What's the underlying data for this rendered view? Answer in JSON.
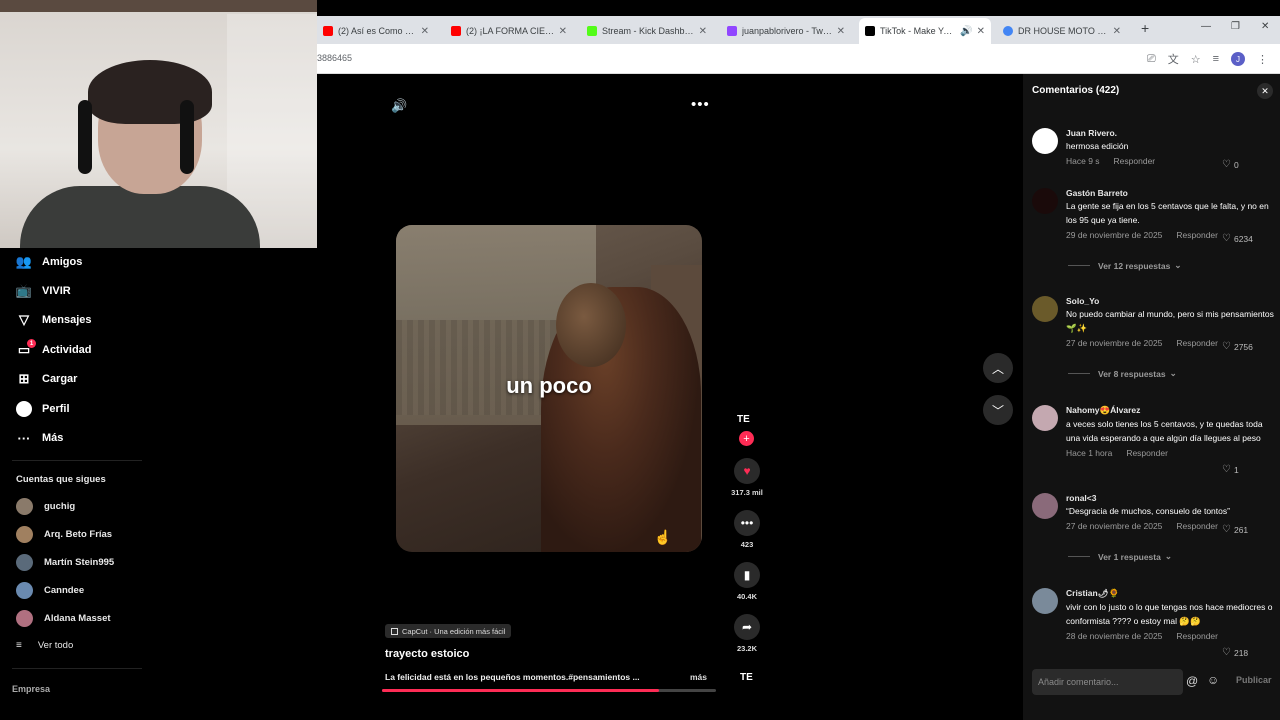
{
  "browser": {
    "tabs": [
      {
        "label": "(2) Así es Como Debes Ent",
        "color": "#ff0000"
      },
      {
        "label": "(2) ¡LA FORMA CIENTÍFICA",
        "color": "#ff0000"
      },
      {
        "label": "Stream - Kick Dashboard",
        "color": "#53fc18"
      },
      {
        "label": "juanpablorivero - Twitch",
        "color": "#9146ff"
      },
      {
        "label": "TikTok - Make Your D",
        "color": "#000000"
      },
      {
        "label": "DR HOUSE MOTO - Busc",
        "color": "#4285f4"
      }
    ],
    "address": "3886465",
    "profile_initial": "J"
  },
  "sidebar": {
    "nav": [
      {
        "label": "Amigos",
        "icon": "friends-icon"
      },
      {
        "label": "VIVIR",
        "icon": "live-icon"
      },
      {
        "label": "Mensajes",
        "icon": "messages-icon"
      },
      {
        "label": "Actividad",
        "icon": "activity-icon",
        "badge": "1"
      },
      {
        "label": "Cargar",
        "icon": "upload-icon"
      },
      {
        "label": "Perfil",
        "icon": "profile-icon"
      },
      {
        "label": "Más",
        "icon": "more-icon"
      }
    ],
    "following_title": "Cuentas que sigues",
    "following": [
      {
        "name": "guchig",
        "color": "#8a7a6a"
      },
      {
        "name": "Arq. Beto Frías",
        "color": "#a08060"
      },
      {
        "name": "Martín Stein995",
        "color": "#5a6a7a"
      },
      {
        "name": "Canndee",
        "color": "#6a8ab0"
      },
      {
        "name": "Aldana Masset",
        "color": "#b07080"
      }
    ],
    "see_all": "Ver todo",
    "footer": "Empresa"
  },
  "video": {
    "caption_overlay": "un poco",
    "likes": "317.3 mil",
    "comments_count": "423",
    "saves": "40.4K",
    "shares": "23.2K",
    "creator_mark": "TE",
    "capcut_tag": "CapCut · Una edición más fácil",
    "author": "trayecto estoico",
    "description": "La felicidad está en los pequeños momentos.#pensamientos ...",
    "more_label": "más",
    "progress": 0.83,
    "accent": "#fe2c55"
  },
  "comments_panel": {
    "title": "Comentarios (422)",
    "items": [
      {
        "user": "Juan Rivero.",
        "text": "hermosa edición",
        "date": "Hace 9 s",
        "reply": "Responder",
        "likes": "0",
        "avatar": "#ffffff"
      },
      {
        "user": "Gastón Barreto",
        "text": "La gente se fija en los 5 centavos que le falta, y no en los 95 que ya tiene.",
        "date": "29 de noviembre de 2025",
        "reply": "Responder",
        "likes": "6234",
        "avatar": "#1a0a0a",
        "replies": "Ver 12 respuestas"
      },
      {
        "user": "Solo_Yo",
        "text": "No puedo cambiar al mundo, pero si mis pensamientos 🌱✨",
        "date": "27 de noviembre de 2025",
        "reply": "Responder",
        "likes": "2756",
        "avatar": "#6a5a2a",
        "replies": "Ver 8 respuestas"
      },
      {
        "user": "Nahomy😍Álvarez",
        "text": "a veces solo tienes los 5 centavos, y te quedas toda una vida esperando a que algún día llegues al peso",
        "date": "Hace 1 hora",
        "reply": "Responder",
        "likes": "1",
        "avatar": "#c4a8b0"
      },
      {
        "user": "ronal<3",
        "text": "“Desgracia de muchos, consuelo de tontos”",
        "date": "27 de noviembre de 2025",
        "reply": "Responder",
        "likes": "261",
        "avatar": "#8a6a7a",
        "replies": "Ver 1 respuesta"
      },
      {
        "user": "Cristian🌶🌻",
        "text": "vivir con lo justo o lo que tengas nos hace mediocres o conformista ???? o estoy mal 🤔🤔",
        "date": "28 de noviembre de 2025",
        "reply": "Responder",
        "likes": "218",
        "avatar": "#7a8a9a"
      }
    ],
    "input_placeholder": "Añadir comentario...",
    "publish": "Publicar"
  }
}
